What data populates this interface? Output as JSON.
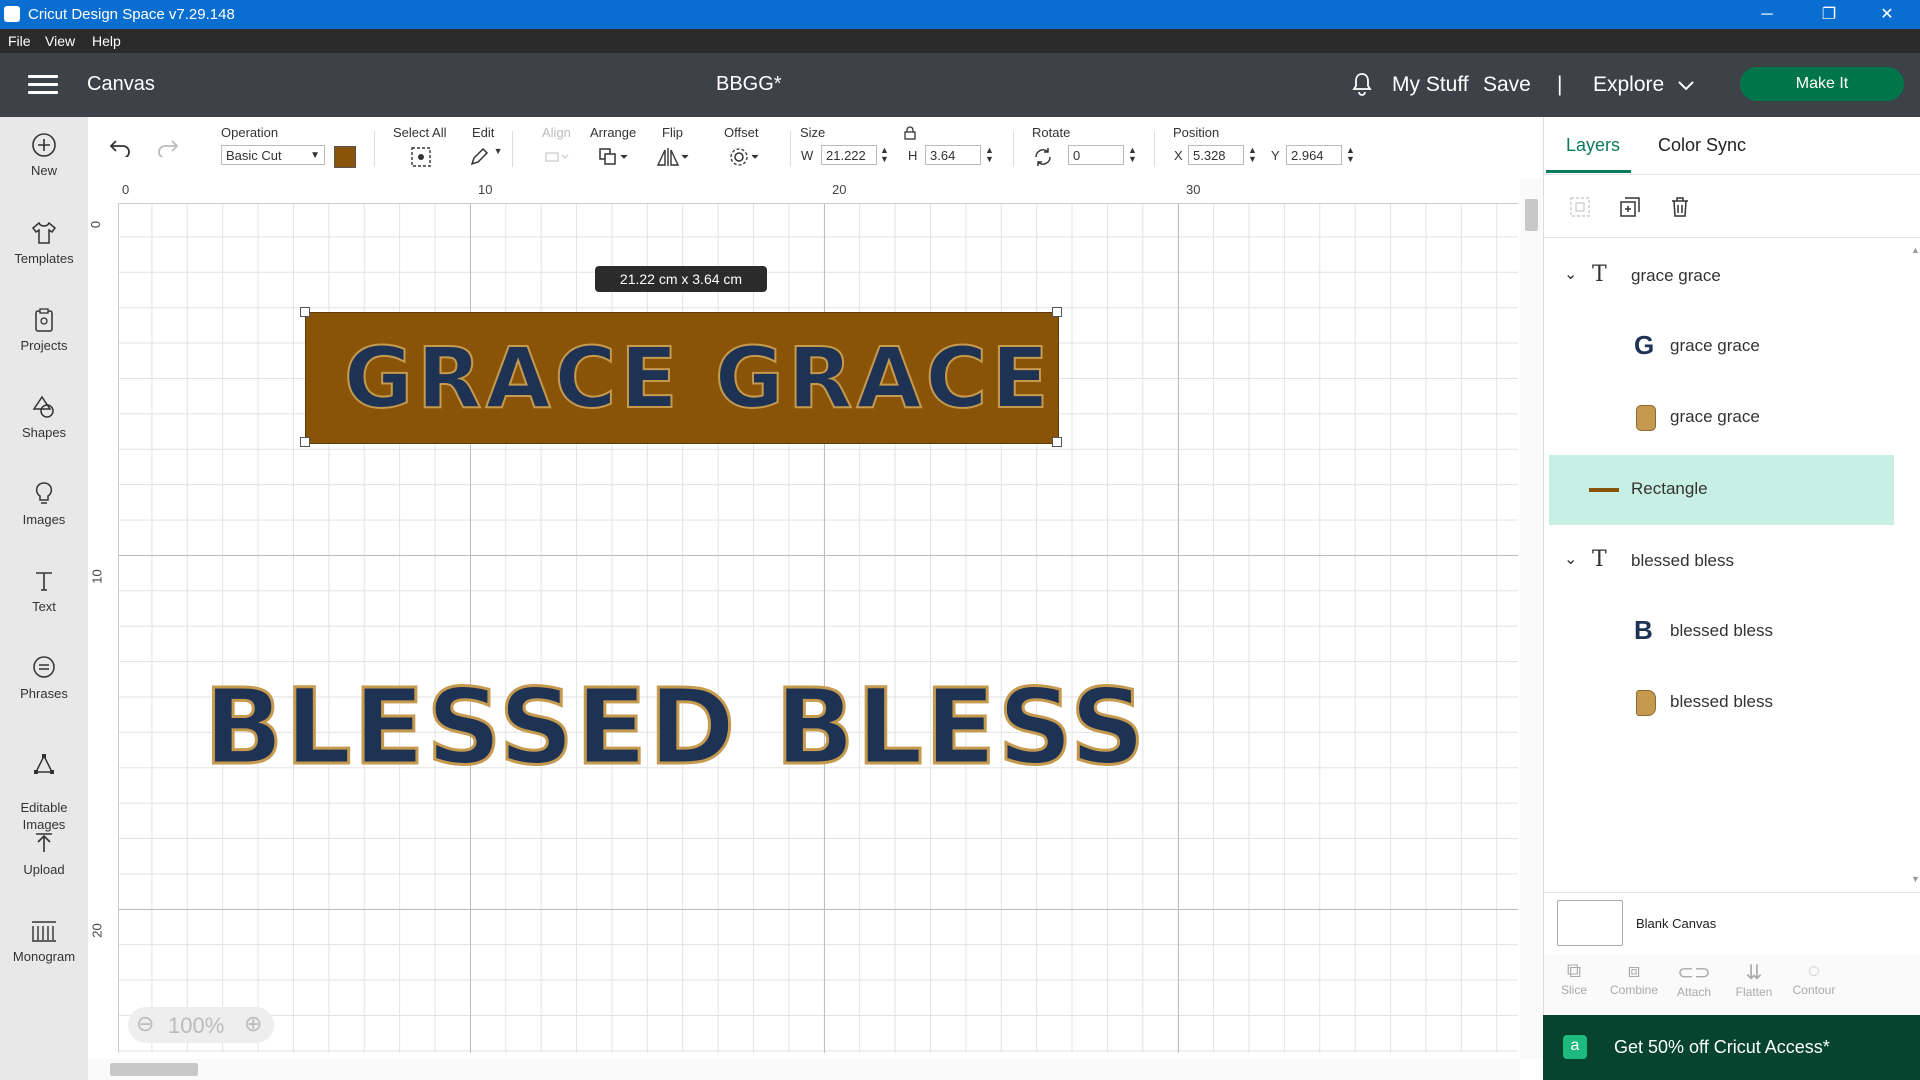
{
  "window": {
    "title": "Cricut Design Space  v7.29.148",
    "controls": [
      "─",
      "❐",
      "✕"
    ]
  },
  "menu": [
    "File",
    "View",
    "Help"
  ],
  "header": {
    "section": "Canvas",
    "document_title": "BBGG*",
    "my_stuff": "My Stuff",
    "save": "Save",
    "divider": "|",
    "explore": "Explore",
    "make_it": "Make It"
  },
  "sidebar": {
    "items": [
      {
        "label": "New",
        "icon": "plus-circle-icon"
      },
      {
        "label": "Templates",
        "icon": "tshirt-icon"
      },
      {
        "label": "Projects",
        "icon": "clipboard-icon"
      },
      {
        "label": "Shapes",
        "icon": "shapes-icon"
      },
      {
        "label": "Images",
        "icon": "lightbulb-icon"
      },
      {
        "label": "Text",
        "icon": "text-icon"
      },
      {
        "label": "Phrases",
        "icon": "speech-bubble-icon"
      },
      {
        "label": "Editable\nImages",
        "icon": "editable-images-icon"
      },
      {
        "label": "Upload",
        "icon": "upload-icon"
      },
      {
        "label": "Monogram",
        "icon": "monogram-icon"
      }
    ]
  },
  "toolbar": {
    "operation_label": "Operation",
    "operation_value": "Basic Cut",
    "operation_color": "#8a5408",
    "select_all": "Select All",
    "edit": "Edit",
    "align": "Align",
    "arrange": "Arrange",
    "flip": "Flip",
    "offset": "Offset",
    "size_label": "Size",
    "w_label": "W",
    "w_value": "21.222",
    "h_label": "H",
    "h_value": "3.64",
    "rotate_label": "Rotate",
    "rotate_value": "0",
    "position_label": "Position",
    "x_label": "X",
    "x_value": "5.328",
    "y_label": "Y",
    "y_value": "2.964"
  },
  "canvas": {
    "ruler_top": [
      "0",
      "10",
      "20",
      "30"
    ],
    "ruler_left": [
      "0",
      "10",
      "20"
    ],
    "size_tooltip": "21.22  cm x 3.64  cm",
    "text1": "GRACE GRACE",
    "text2": "BLESSED BLESS",
    "zoom": "100%",
    "colors": {
      "rectangle": "#8a5408",
      "letters": "#1e3354",
      "outline": "#c59a4e"
    }
  },
  "right_panel": {
    "tabs": [
      "Layers",
      "Color Sync"
    ],
    "layers": [
      {
        "label": "grace grace",
        "kind": "group"
      },
      {
        "label": "grace grace",
        "kind": "child-letter",
        "glyph": "G"
      },
      {
        "label": "grace grace",
        "kind": "child-shape"
      },
      {
        "label": "Rectangle",
        "kind": "selected"
      },
      {
        "label": "blessed bless",
        "kind": "group"
      },
      {
        "label": "blessed bless",
        "kind": "child-letter",
        "glyph": "B"
      },
      {
        "label": "blessed bless",
        "kind": "child-shape"
      }
    ],
    "blank_canvas": "Blank Canvas",
    "actions": [
      "Slice",
      "Combine",
      "Attach",
      "Flatten",
      "Contour"
    ],
    "promo": "Get 50% off Cricut Access*"
  }
}
